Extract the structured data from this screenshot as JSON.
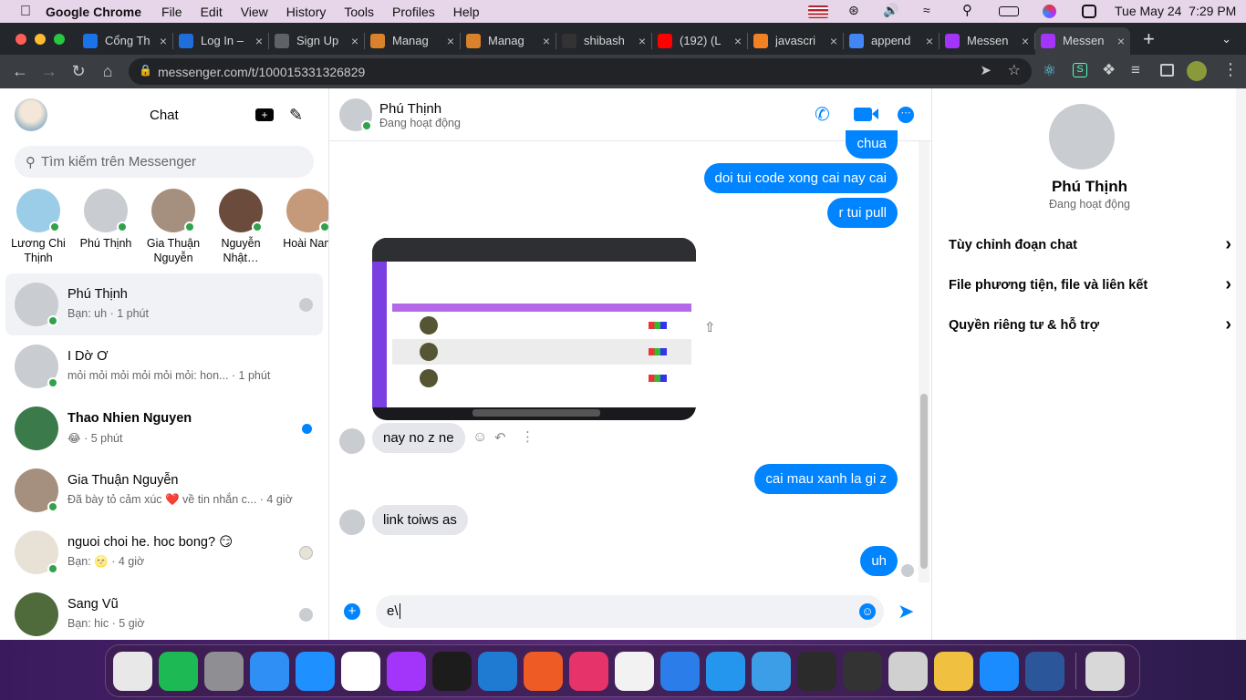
{
  "menubar": {
    "app_name": "Google Chrome",
    "items": [
      "File",
      "Edit",
      "View",
      "History",
      "Tools",
      "Profiles",
      "Help"
    ],
    "datetime": "Tue May 24  7:29 PM"
  },
  "tabs": [
    {
      "title": "Cổng Th",
      "color": "#1a73e8"
    },
    {
      "title": "Log In –",
      "color": "#1e6fd9"
    },
    {
      "title": "Sign Up",
      "color": "#5f6368"
    },
    {
      "title": "Manag",
      "color": "#d9822b"
    },
    {
      "title": "Manag",
      "color": "#d9822b"
    },
    {
      "title": "shibash",
      "color": "#333333"
    },
    {
      "title": "(192) (L",
      "color": "#ff0000"
    },
    {
      "title": "javascri",
      "color": "#f48024"
    },
    {
      "title": "append",
      "color": "#4285f4"
    },
    {
      "title": "Messen",
      "color": "#a334fa"
    },
    {
      "title": "Messen",
      "color": "#a334fa"
    }
  ],
  "address_bar": {
    "url": "messenger.com/t/100015331326829"
  },
  "sidebar": {
    "title": "Chat",
    "search_placeholder": "Tìm kiếm trên Messenger",
    "stories": [
      {
        "name": "Lương Chi Thịnh",
        "color": "#9ccde8"
      },
      {
        "name": "Phú Thịnh",
        "color": "#c9ccd1"
      },
      {
        "name": "Gia Thuận Nguyễn",
        "color": "#a58f7e"
      },
      {
        "name": "Nguyễn Nhật…",
        "color": "#6b4b3b"
      },
      {
        "name": "Hoài Nam",
        "color": "#c49a7a"
      }
    ],
    "conversations": [
      {
        "name": "Phú Thịnh",
        "message": "Bạn: uh · 1 phút",
        "bold": false,
        "color": "#c9ccd1"
      },
      {
        "name": "I Dờ Ơ",
        "message": "mỏi mỏi mỏi mỏi mỏi mỏi: hon... · 1 phút",
        "bold": false,
        "color": "#c9ccd1"
      },
      {
        "name": "Thao Nhien Nguyen",
        "message": "😂 · 5 phút",
        "bold": true,
        "color": "#3b7a4a"
      },
      {
        "name": "Gia Thuận Nguyễn",
        "message": "Đã bày tỏ cảm xúc ❤️ về tin nhắn c... · 4 giờ",
        "bold": false,
        "color": "#a58f7e"
      },
      {
        "name": "nguoi choi he. hoc bong? 😏",
        "message": "Bạn: 🌝 · 4 giờ",
        "bold": false,
        "color": "#e8e2d6"
      },
      {
        "name": "Sang Vũ",
        "message": "Bạn: hic · 5 giờ",
        "bold": false,
        "color": "#4f6b3c"
      }
    ]
  },
  "chat": {
    "contact_name": "Phú Thịnh",
    "contact_status": "Đang hoạt động",
    "messages": [
      {
        "text": "chua",
        "side": "out"
      },
      {
        "text": "doi tui code xong cai nay cai",
        "side": "out"
      },
      {
        "text": "r tui pull",
        "side": "out"
      },
      {
        "text": "[screenshot image]",
        "side": "in-image"
      },
      {
        "text": "nay no z ne",
        "side": "in"
      },
      {
        "text": "cai mau xanh la gi z",
        "side": "out"
      },
      {
        "text": "link toiws as",
        "side": "in"
      },
      {
        "text": "uh",
        "side": "out"
      }
    ],
    "composer_value": "e\\"
  },
  "right_panel": {
    "name": "Phú Thịnh",
    "status": "Đang hoạt động",
    "menu": [
      "Tùy chỉnh đoạn chat",
      "File phương tiện, file và liên kết",
      "Quyền riêng tư & hỗ trợ"
    ]
  },
  "dock": [
    {
      "name": "Launchpad",
      "color": "#e8e8e8"
    },
    {
      "name": "Spotify",
      "color": "#1db954"
    },
    {
      "name": "System Preferences",
      "color": "#8e8e93"
    },
    {
      "name": "Finder",
      "color": "#2f8ff5"
    },
    {
      "name": "Safari",
      "color": "#1e90ff"
    },
    {
      "name": "Chrome",
      "color": "#ffffff"
    },
    {
      "name": "Messenger",
      "color": "#a334fa"
    },
    {
      "name": "Terminal",
      "color": "#1c1c1c"
    },
    {
      "name": "VS Code",
      "color": "#1f7bd1"
    },
    {
      "name": "Postman",
      "color": "#ef5b25"
    },
    {
      "name": "IntelliJ",
      "color": "#e6336a"
    },
    {
      "name": "Xcode-like",
      "color": "#f2f2f2"
    },
    {
      "name": "Xcode",
      "color": "#2b7de9"
    },
    {
      "name": "Docker",
      "color": "#2496ed"
    },
    {
      "name": "Network",
      "color": "#3c9ee6"
    },
    {
      "name": "OBS",
      "color": "#2b2b2b"
    },
    {
      "name": "iPhone",
      "color": "#333333"
    },
    {
      "name": "Screenshot",
      "color": "#d0d0d0"
    },
    {
      "name": "Photos",
      "color": "#f0c040"
    },
    {
      "name": "App Store",
      "color": "#1a8cff"
    },
    {
      "name": "Word",
      "color": "#2b579a"
    },
    {
      "name": "Trash",
      "color": "#d8d8d8"
    }
  ]
}
